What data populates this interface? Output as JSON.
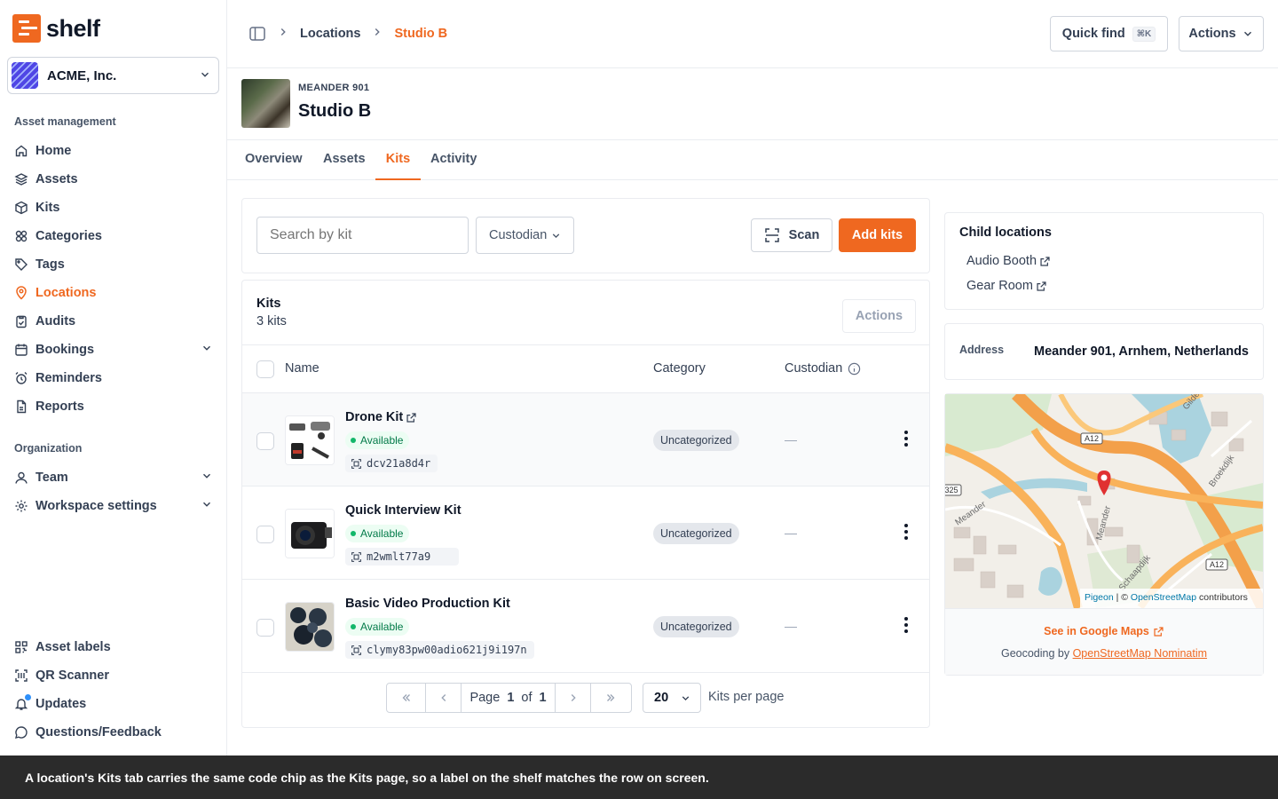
{
  "brand": {
    "name": "shelf",
    "color": "#ef6820"
  },
  "workspace": {
    "name": "ACME, Inc."
  },
  "sidebar": {
    "section_asset": "Asset management",
    "asset_items": [
      {
        "label": "Home",
        "icon": "home-icon"
      },
      {
        "label": "Assets",
        "icon": "assets-icon"
      },
      {
        "label": "Kits",
        "icon": "kits-icon"
      },
      {
        "label": "Categories",
        "icon": "categories-icon"
      },
      {
        "label": "Tags",
        "icon": "tag-icon"
      },
      {
        "label": "Locations",
        "icon": "location-pin-icon",
        "active": true
      },
      {
        "label": "Audits",
        "icon": "clipboard-icon"
      },
      {
        "label": "Bookings",
        "icon": "calendar-icon",
        "expandable": true
      },
      {
        "label": "Reminders",
        "icon": "alarm-clock-icon"
      },
      {
        "label": "Reports",
        "icon": "report-icon"
      }
    ],
    "section_org": "Organization",
    "org_items": [
      {
        "label": "Team",
        "icon": "user-icon",
        "expandable": true
      },
      {
        "label": "Workspace settings",
        "icon": "gear-icon",
        "expandable": true
      }
    ],
    "bottom_items": [
      {
        "label": "Asset labels",
        "icon": "qr-grid-icon"
      },
      {
        "label": "QR Scanner",
        "icon": "scan-icon"
      },
      {
        "label": "Updates",
        "icon": "bell-icon"
      },
      {
        "label": "Questions/Feedback",
        "icon": "chat-bubble-icon"
      }
    ]
  },
  "header": {
    "breadcrumbs": [
      "Locations",
      "Studio B"
    ],
    "quick_find": "Quick find",
    "quick_find_shortcut": "⌘K",
    "actions": "Actions"
  },
  "location": {
    "address_line": "MEANDER 901",
    "name": "Studio B",
    "tabs": [
      "Overview",
      "Assets",
      "Kits",
      "Activity"
    ],
    "active_tab": "Kits"
  },
  "filters": {
    "search_placeholder": "Search by kit",
    "custodian": "Custodian",
    "scan": "Scan",
    "add_kits": "Add kits"
  },
  "kits_table": {
    "title": "Kits",
    "count": "3 kits",
    "actions": "Actions",
    "columns": {
      "name": "Name",
      "category": "Category",
      "custodian": "Custodian"
    },
    "rows": [
      {
        "name": "Drone Kit",
        "status": "Available",
        "code": "dcv21a8d4r",
        "category": "Uncategorized",
        "custodian": "—"
      },
      {
        "name": "Quick Interview Kit",
        "status": "Available",
        "code": "m2wmlt77a9",
        "category": "Uncategorized",
        "custodian": "—"
      },
      {
        "name": "Basic Video Production Kit",
        "status": "Available",
        "code": "clymy83pw00adio621j9i197n",
        "category": "Uncategorized",
        "custodian": "—"
      }
    ],
    "pagination": {
      "page_label": "Page",
      "page": "1",
      "of_label": "of",
      "total_pages": "1",
      "per_page": "20",
      "per_page_label": "Kits per page"
    }
  },
  "right_panel": {
    "child_locations_title": "Child locations",
    "child_locations": [
      "Audio Booth",
      "Gear Room"
    ],
    "address_label": "Address",
    "address_value": "Meander 901, Arnhem, Netherlands",
    "map_labels": {
      "road_a12_top": "A12",
      "road_a12_bottom": "A12",
      "road_325": "325",
      "street_meander_left": "Meander",
      "street_meander_center": "Meander",
      "street_broekdijk": "Broekdijk",
      "street_schaapdijk": "Schaapdijk",
      "street_gildemate": "Gilde"
    },
    "map_attribution_pigeon": "Pigeon",
    "map_attribution_sep": " | © ",
    "map_attribution_osm": "OpenStreetMap",
    "map_attribution_suffix": " contributors",
    "google_maps": "See in Google Maps",
    "geocoding_prefix": "Geocoding by ",
    "geocoding_link": "OpenStreetMap Nominatim"
  },
  "caption": "A location's Kits tab carries the same code chip as the Kits page, so a label on the shelf matches the row on screen."
}
